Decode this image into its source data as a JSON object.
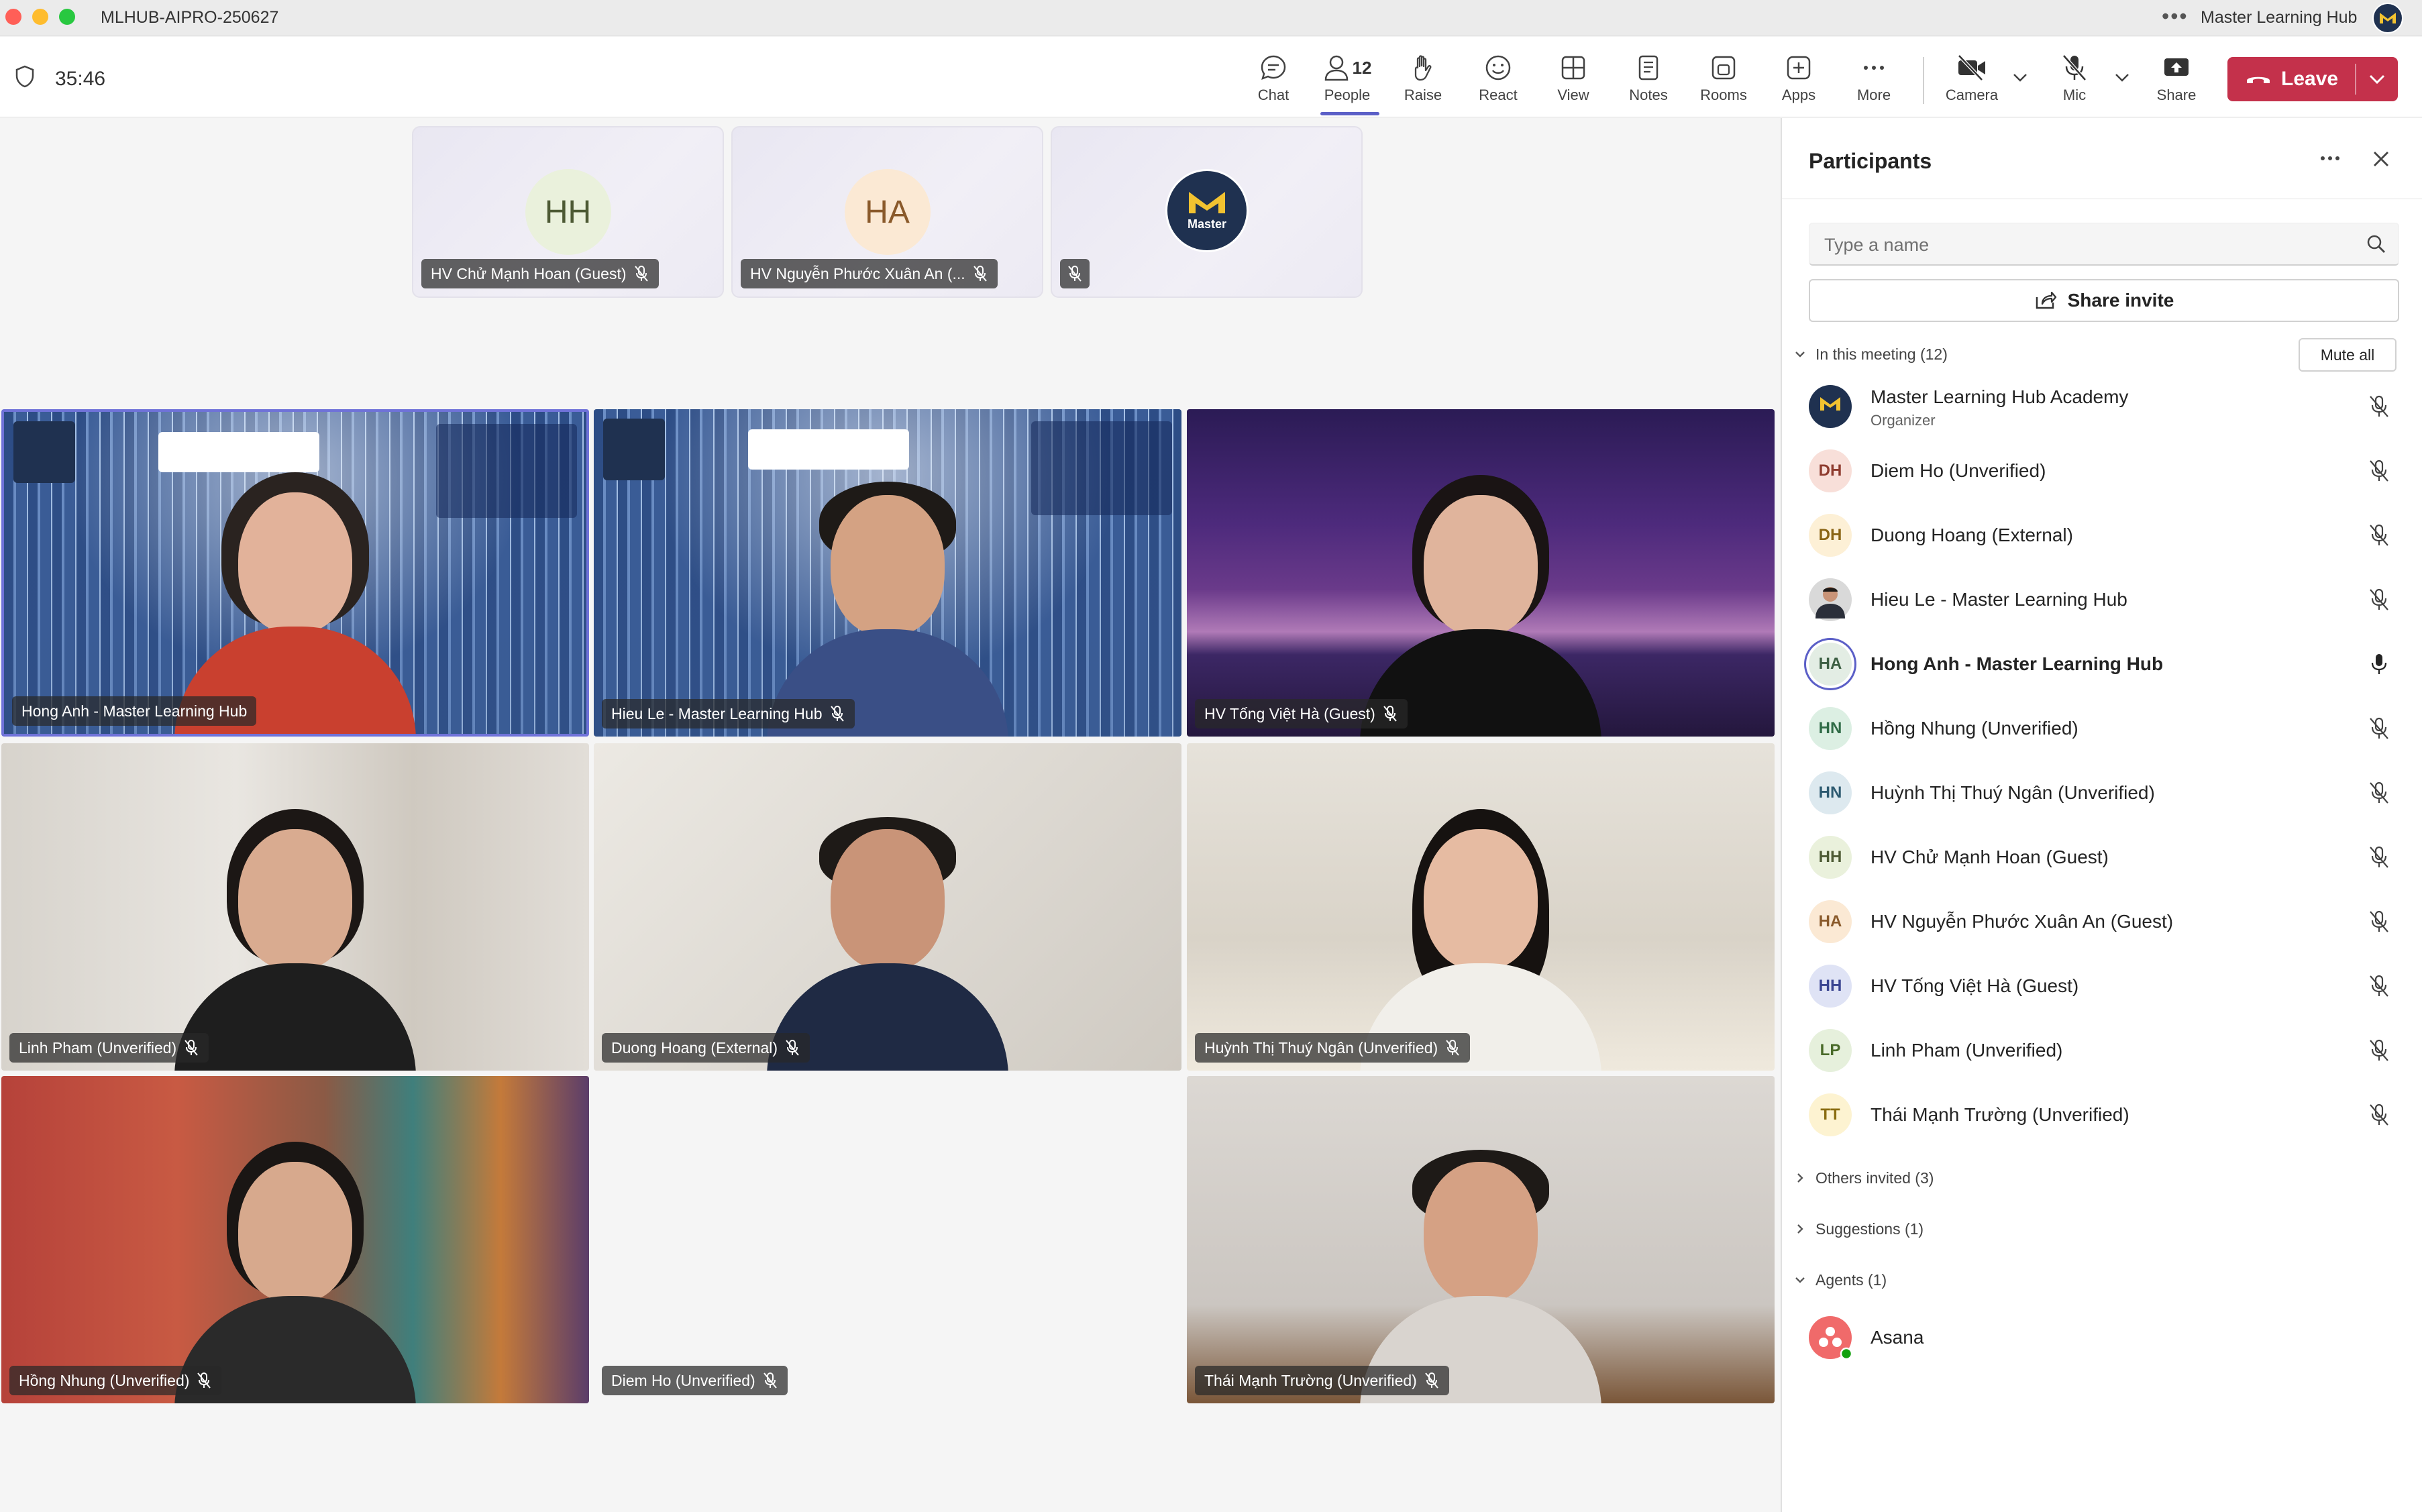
{
  "window": {
    "title": "MLHUB-AIPRO-250627",
    "account_name": "Master Learning Hub",
    "more_glyph": "•••"
  },
  "toolbar": {
    "timer": "35:46",
    "people_count": "12",
    "items": {
      "chat": "Chat",
      "people": "People",
      "raise": "Raise",
      "react": "React",
      "view": "View",
      "notes": "Notes",
      "rooms": "Rooms",
      "apps": "Apps",
      "more": "More",
      "camera": "Camera",
      "mic": "Mic",
      "share": "Share"
    },
    "leave_label": "Leave"
  },
  "audio_tiles": [
    {
      "initials": "HH",
      "name": "HV Chử Mạnh Hoan (Guest)",
      "avatar_bg": "#eaf1dc",
      "avatar_fg": "#4d5a34"
    },
    {
      "initials": "HA",
      "name": "HV Nguyễn Phước Xuân An (...",
      "avatar_bg": "#fbe9d4",
      "avatar_fg": "#8a5a2b"
    },
    {
      "initials": "",
      "name": "",
      "avatar_bg": "#1f3150",
      "avatar_fg": "#ffffff"
    }
  ],
  "video_tiles": [
    {
      "name": "Hong Anh - Master Learning Hub"
    },
    {
      "name": "Hieu Le - Master Learning Hub"
    },
    {
      "name": "HV Tống Việt Hà (Guest)"
    },
    {
      "name": "Linh Pham (Unverified)"
    },
    {
      "name": "Duong Hoang (External)"
    },
    {
      "name": "Huỳnh Thị Thuý Ngân (Unverified)"
    },
    {
      "name": "Hồng Nhung (Unverified)"
    },
    {
      "name": "Diem Ho (Unverified)"
    },
    {
      "name": "Thái Mạnh Trường (Unverified)"
    }
  ],
  "panel": {
    "title": "Participants",
    "search_placeholder": "Type a name",
    "share_invite": "Share invite",
    "in_meeting_label": "In this meeting (12)",
    "mute_all": "Mute all",
    "participants": [
      {
        "initials": "",
        "name": "Master Learning Hub Academy",
        "role": "Organizer",
        "avatar_bg": "#1f3150",
        "avatar_fg": "#ffffff"
      },
      {
        "initials": "DH",
        "name": "Diem Ho (Unverified)",
        "avatar_bg": "#f8dfd9",
        "avatar_fg": "#8e3b2e"
      },
      {
        "initials": "DH",
        "name": "Duong Hoang (External)",
        "avatar_bg": "#fdf0d6",
        "avatar_fg": "#8a6414"
      },
      {
        "initials": "",
        "name": "Hieu Le - Master Learning Hub",
        "avatar_bg": "#d9d9d9",
        "avatar_fg": "#333333"
      },
      {
        "initials": "HA",
        "name": "Hong Anh - Master Learning Hub",
        "avatar_bg": "#e3ede4",
        "avatar_fg": "#3d5f43"
      },
      {
        "initials": "HN",
        "name": "Hồng Nhung (Unverified)",
        "avatar_bg": "#dcefe3",
        "avatar_fg": "#2f6b46"
      },
      {
        "initials": "HN",
        "name": "Huỳnh Thị Thuý Ngân (Unverified)",
        "avatar_bg": "#dde9ef",
        "avatar_fg": "#2d5a70"
      },
      {
        "initials": "HH",
        "name": "HV Chử Mạnh Hoan (Guest)",
        "avatar_bg": "#eaf1dc",
        "avatar_fg": "#4d5a34"
      },
      {
        "initials": "HA",
        "name": "HV Nguyễn Phước Xuân An (Guest)",
        "avatar_bg": "#fbe9d4",
        "avatar_fg": "#8a5a2b"
      },
      {
        "initials": "HH",
        "name": "HV Tống Việt Hà (Guest)",
        "avatar_bg": "#dfe3f5",
        "avatar_fg": "#3a4591"
      },
      {
        "initials": "LP",
        "name": "Linh Pham (Unverified)",
        "avatar_bg": "#e6f0dc",
        "avatar_fg": "#4a6b2a"
      },
      {
        "initials": "TT",
        "name": "Thái Mạnh Trường (Unverified)",
        "avatar_bg": "#fdf3d1",
        "avatar_fg": "#8a6d12"
      }
    ],
    "others_invited": "Others invited (3)",
    "suggestions": "Suggestions (1)",
    "agents": "Agents (1)",
    "agent_name": "Asana"
  },
  "colors": {
    "accent": "#5b5fc7",
    "leave": "#c4314b",
    "organizer_badge": "#1f3150"
  }
}
